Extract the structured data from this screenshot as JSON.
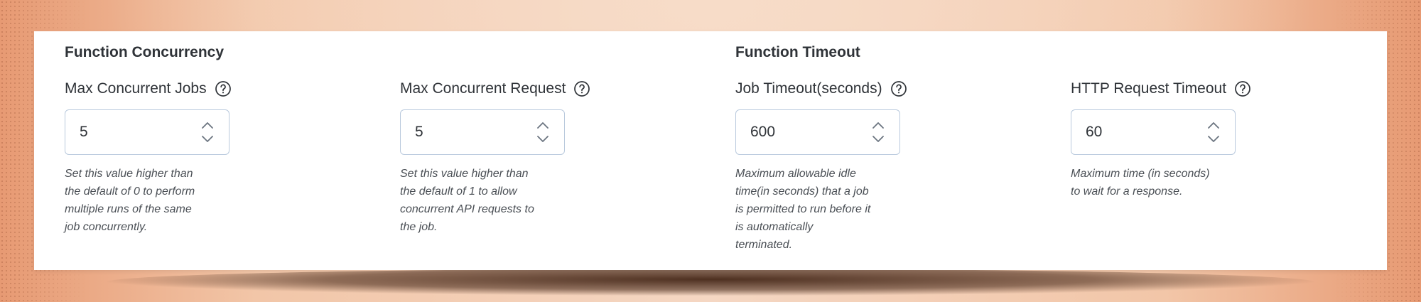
{
  "sections": {
    "concurrency_title": "Function Concurrency",
    "timeout_title": "Function Timeout"
  },
  "fields": [
    {
      "label": "Max Concurrent Jobs",
      "value": "5",
      "help_icon": "question-circle-icon",
      "helper": "Set this value higher than\nthe default of 0 to perform\nmultiple runs of the same\njob concurrently."
    },
    {
      "label": "Max Concurrent Request",
      "value": "5",
      "help_icon": "question-circle-icon",
      "helper": "Set this value higher than\nthe default of 1 to allow\nconcurrent API requests to\nthe job."
    },
    {
      "label": "Job Timeout(seconds)",
      "value": "600",
      "help_icon": "question-circle-icon",
      "helper": "Maximum allowable idle\ntime(in seconds) that a job\nis permitted to run before it\nis automatically\nterminated."
    },
    {
      "label": "HTTP Request Timeout",
      "value": "60",
      "help_icon": "question-circle-icon",
      "helper": "Maximum time (in seconds)\nto wait for a response."
    }
  ],
  "stepper_icons": {
    "up": "chevron-up-icon",
    "down": "chevron-down-icon"
  },
  "colors": {
    "panel_background": "#ffffff",
    "input_border": "#b9c9dd",
    "text": "#2f3338",
    "helper_text": "#4a4f55",
    "backdrop": "#f2c6a8"
  }
}
